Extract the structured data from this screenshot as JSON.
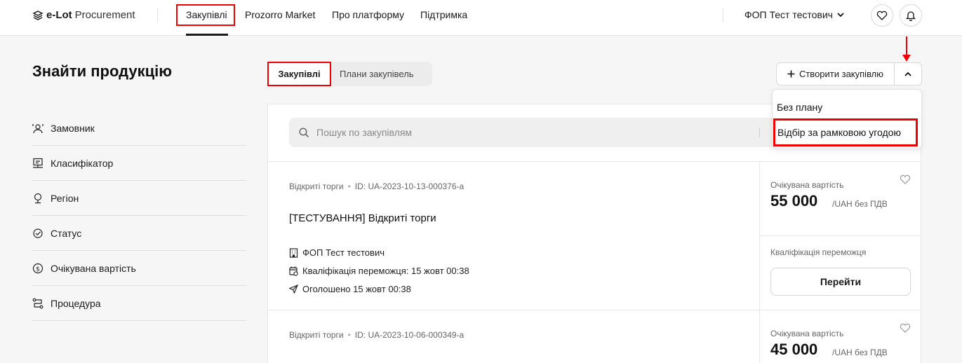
{
  "header": {
    "logo_bold": "e-Lot",
    "logo_light": "Procurement",
    "nav": [
      "Закупівлі",
      "Prozorro Market",
      "Про платформу",
      "Підтримка"
    ],
    "user_name": "ФОП Тест тестович"
  },
  "sidebar": {
    "title": "Знайти продукцію",
    "filters": [
      {
        "label": "Замовник",
        "icon": "customer-icon"
      },
      {
        "label": "Класифікатор",
        "icon": "classifier-icon"
      },
      {
        "label": "Регіон",
        "icon": "region-icon"
      },
      {
        "label": "Статус",
        "icon": "status-icon"
      },
      {
        "label": "Очікувана вартість",
        "icon": "money-icon"
      },
      {
        "label": "Процедура",
        "icon": "procedure-icon"
      }
    ]
  },
  "tabs": {
    "active": "Закупівлі",
    "second": "Плани закупівель"
  },
  "create_button": "Створити закупівлю",
  "dropdown": {
    "items": [
      "Без плану",
      "Відбір за рамковою угодою"
    ]
  },
  "search": {
    "placeholder": "Пошук по закупівлям"
  },
  "tenders": [
    {
      "type": "Відкриті торги",
      "id": "ID: UA-2023-10-13-000376-a",
      "title": "[ТЕСТУВАННЯ] Відкриті торги",
      "org": "ФОП Тест тестович",
      "qualification": "Кваліфікація переможця: 15 жовт 00:38",
      "announced": "Оголошено 15 жовт 00:38",
      "price_label": "Очікувана вартість",
      "price": "55 000",
      "price_unit": "/UAH без ПДВ",
      "status": "Кваліфікація переможця",
      "action": "Перейти"
    },
    {
      "type": "Відкриті торги",
      "id": "ID: UA-2023-10-06-000349-a",
      "price_label": "Очікувана вартість",
      "price": "45 000",
      "price_unit": "/UAH без ПДВ"
    }
  ],
  "colors": {
    "highlight": "#ee0000",
    "background": "#f6f6f6"
  }
}
